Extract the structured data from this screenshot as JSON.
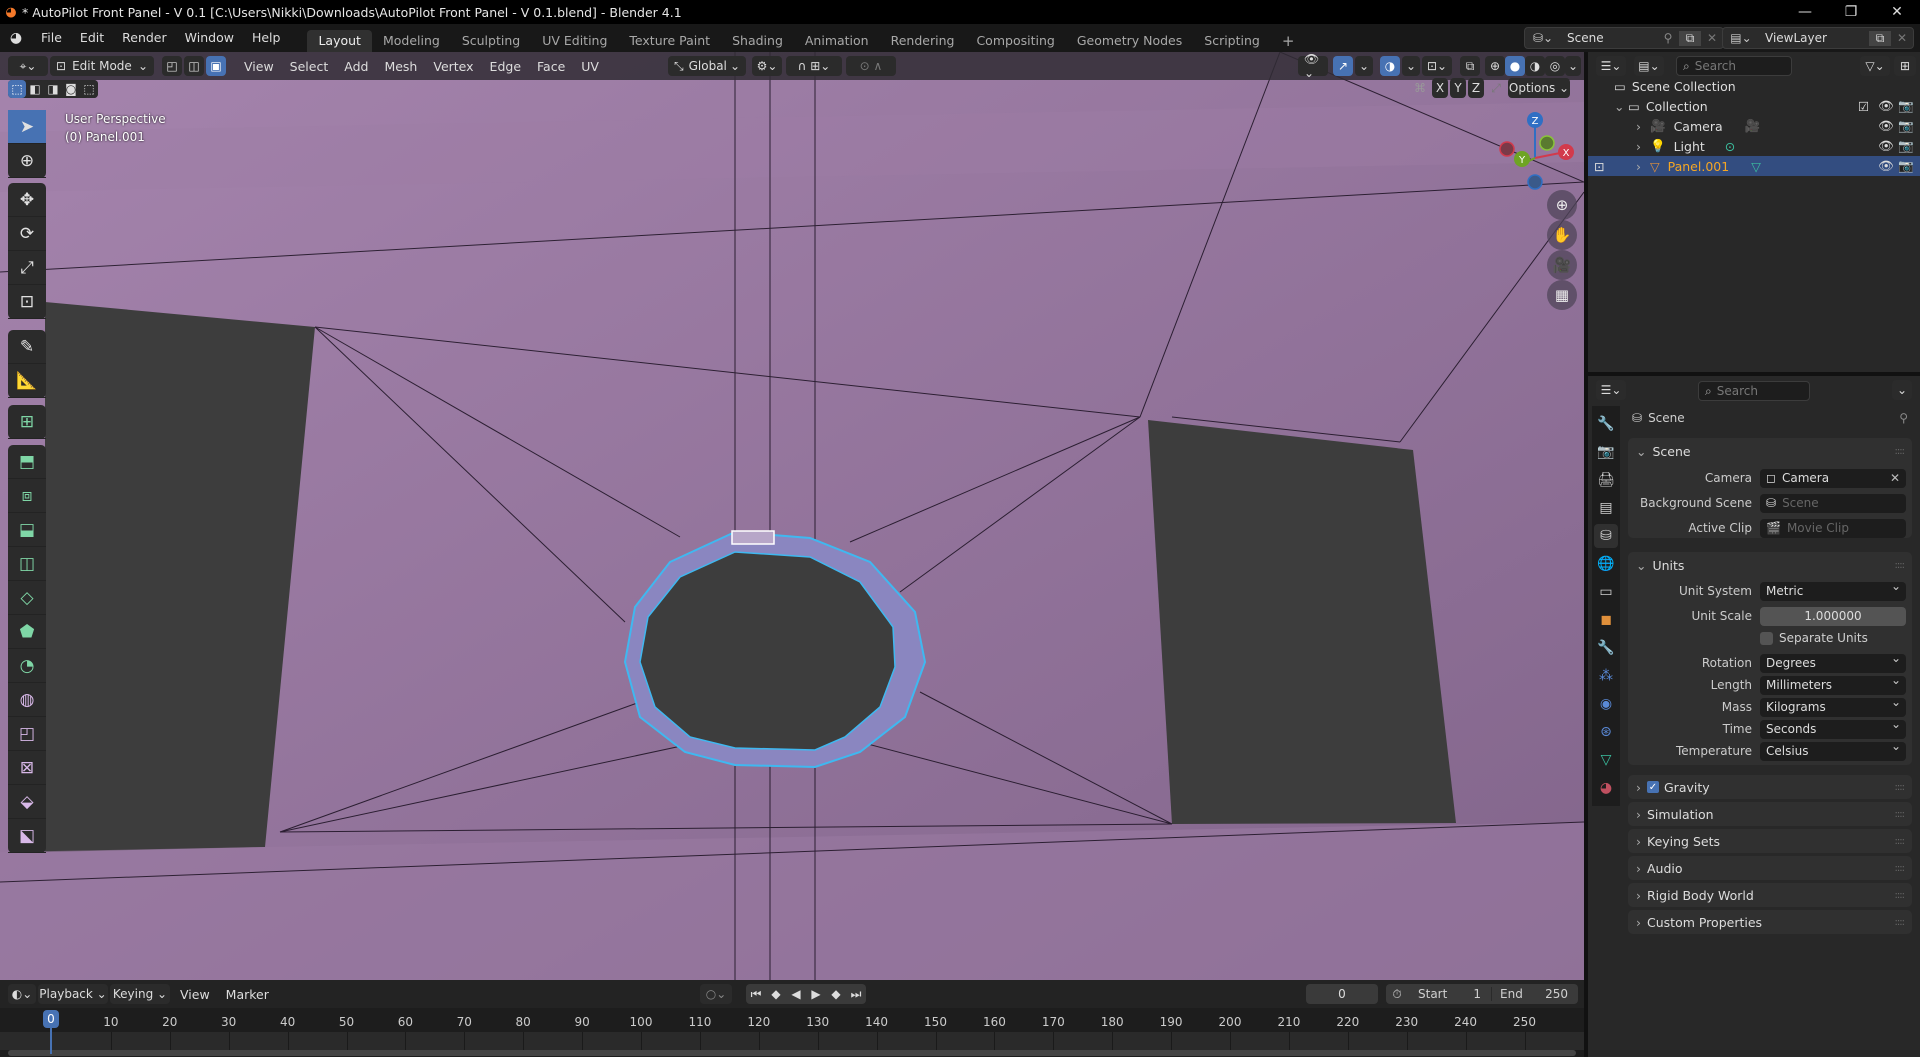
{
  "window": {
    "title": "* AutoPilot Front Panel - V 0.1 [C:\\Users\\Nikki\\Downloads\\AutoPilot Front Panel - V 0.1.blend] - Blender 4.1",
    "minimize": "—",
    "maximize": "❐",
    "close": "✕"
  },
  "menu": [
    "File",
    "Edit",
    "Render",
    "Window",
    "Help"
  ],
  "workspaces": [
    "Layout",
    "Modeling",
    "Sculpting",
    "UV Editing",
    "Texture Paint",
    "Shading",
    "Animation",
    "Rendering",
    "Compositing",
    "Geometry Nodes",
    "Scripting"
  ],
  "workspace_add": "+",
  "active_workspace": "Layout",
  "scene_selector": {
    "value": "Scene"
  },
  "viewlayer_selector": {
    "value": "ViewLayer"
  },
  "viewport_header": {
    "mode": "Edit Mode",
    "menus": [
      "View",
      "Select",
      "Add",
      "Mesh",
      "Vertex",
      "Edge",
      "Face",
      "UV"
    ],
    "orientation": "Global",
    "options_label": "Options",
    "axes": [
      "X",
      "Y",
      "Z"
    ]
  },
  "viewport_overlay_text": {
    "line1": "User Perspective",
    "line2": "(0) Panel.001"
  },
  "gizmo": {
    "x": "X",
    "y": "Y",
    "z": "Z"
  },
  "outliner": {
    "search_placeholder": "Search",
    "items": [
      {
        "label": "Scene Collection",
        "level": 0
      },
      {
        "label": "Collection",
        "level": 1
      },
      {
        "label": "Camera",
        "level": 2
      },
      {
        "label": "Light",
        "level": 2
      },
      {
        "label": "Panel.001",
        "level": 2,
        "selected": true
      }
    ]
  },
  "properties": {
    "search_placeholder": "Search",
    "context_title": "Scene",
    "scene_panel": {
      "title": "Scene",
      "camera_label": "Camera",
      "camera_value": "Camera",
      "background_scene_label": "Background Scene",
      "background_scene_placeholder": "Scene",
      "active_clip_label": "Active Clip",
      "active_clip_placeholder": "Movie Clip"
    },
    "units_panel": {
      "title": "Units",
      "unit_system_label": "Unit System",
      "unit_system": "Metric",
      "unit_scale_label": "Unit Scale",
      "unit_scale": "1.000000",
      "separate_units_label": "Separate Units",
      "separate_units": false,
      "rotation_label": "Rotation",
      "rotation": "Degrees",
      "length_label": "Length",
      "length": "Millimeters",
      "mass_label": "Mass",
      "mass": "Kilograms",
      "time_label": "Time",
      "time": "Seconds",
      "temperature_label": "Temperature",
      "temperature": "Celsius"
    },
    "collapsed_panels": [
      {
        "title": "Gravity",
        "checkbox": true
      },
      {
        "title": "Simulation"
      },
      {
        "title": "Keying Sets"
      },
      {
        "title": "Audio"
      },
      {
        "title": "Rigid Body World"
      },
      {
        "title": "Custom Properties"
      }
    ]
  },
  "timeline": {
    "menus": [
      "Playback",
      "Keying",
      "View",
      "Marker"
    ],
    "current_frame": "0",
    "start_label": "Start",
    "start": "1",
    "end_label": "End",
    "end": "250",
    "ticks": [
      "0",
      "10",
      "20",
      "30",
      "40",
      "50",
      "60",
      "70",
      "80",
      "90",
      "100",
      "110",
      "120",
      "130",
      "140",
      "150",
      "160",
      "170",
      "180",
      "190",
      "200",
      "210",
      "220",
      "230",
      "240",
      "250"
    ]
  },
  "colors": {
    "accent": "#4772b3",
    "mesh_face": "#8b6b93",
    "selected_edge": "#3fb8f0",
    "selected_object": "#f5a623"
  }
}
